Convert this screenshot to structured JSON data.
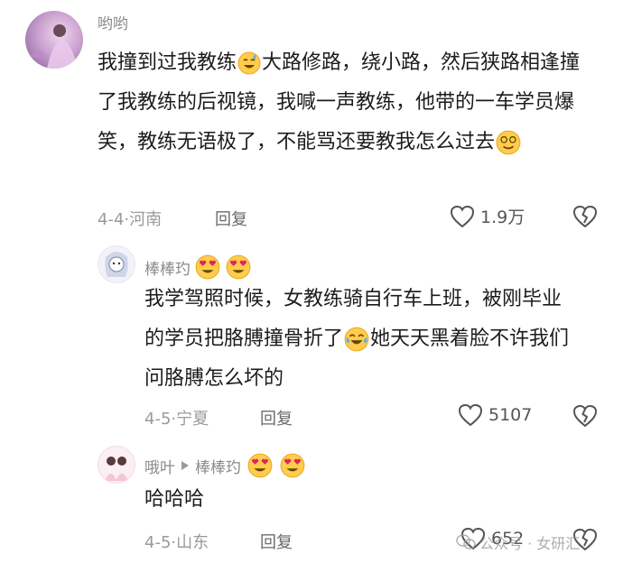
{
  "comments": [
    {
      "user": "哟哟",
      "text_parts": [
        "我撞到过我教练",
        "大路修路，绕小路，然后狭路相逢撞了我教练的后视镜，我喊一声教练，他带的一车学员爆笑，教练无语极了，不能骂还要教我怎么过去"
      ],
      "date": "4-4",
      "location": "河南",
      "reply_label": "回复",
      "likes": "1.9万"
    },
    {
      "user": "棒棒玓",
      "text_parts": [
        "我学驾照时候，女教练骑自行车上班，被刚毕业的学员把胳膊撞骨折了",
        "她天天黑着脸不许我们问胳膊怎么坏的"
      ],
      "date": "4-5",
      "location": "宁夏",
      "reply_label": "回复",
      "likes": "5107"
    },
    {
      "user": "哦叶",
      "reply_to": "棒棒玓",
      "text": "哈哈哈",
      "date": "4-5",
      "location": "山东",
      "reply_label": "回复",
      "likes": "652"
    }
  ],
  "watermark": "公众号 · 女研汇",
  "icons": [
    "heart-icon",
    "broken-heart-icon",
    "reply-arrow-icon",
    "wechat-icon"
  ]
}
